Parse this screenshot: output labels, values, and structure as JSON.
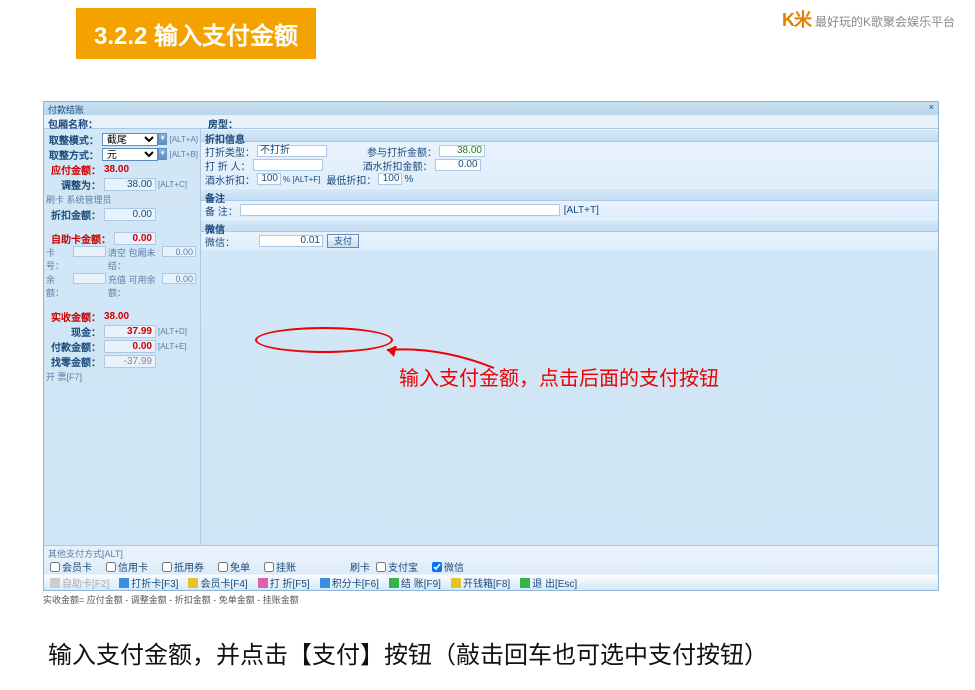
{
  "brand": {
    "logo": "K米",
    "slogan": "最好玩的K歌聚会娱乐平台"
  },
  "slide_title": "3.2.2 输入支付金额",
  "window": {
    "title": "付款结账",
    "room_label": "包厢名称：",
    "type_label": "房型：",
    "left": {
      "round_mode_l": "取整模式：",
      "round_mode_v": "截尾",
      "round_mode_hot": "[ALT+A]",
      "round_way_l": "取整方式：",
      "round_way_v": "元",
      "round_way_hot": "[ALT+B]",
      "pay_l": "应付金额：",
      "pay_v": "38.00",
      "adj_l": "调整为：",
      "adj_v": "38.00",
      "adj_hot": "[ALT+C]",
      "card_user": "刷卡 系统管理员",
      "disc_l": "折扣金额：",
      "disc_v": "0.00",
      "self_l": "自助卡金额：",
      "self_v": "0.00",
      "cardno_l": "卡号：",
      "cardno_v": "",
      "pkg_pending_l": "清空 包厢未结：",
      "pkg_pending_v": "0.00",
      "bal_l": "余额：",
      "bal_v": "",
      "avail_l": "充值 可用余额：",
      "avail_v": "0.00",
      "actual_l": "实收金额：",
      "actual_v": "38.00",
      "cash_l": "现金：",
      "cash_v": "37.99",
      "cash_hot": "[ALT+D]",
      "paid_l": "付款金额：",
      "paid_v": "0.00",
      "paid_hot": "[ALT+E]",
      "change_l": "找零金额：",
      "change_v": "-37.99",
      "invoice": "开 票[F7]"
    },
    "discount_panel": {
      "title": "折扣信息",
      "type_l": "打折类型：",
      "type_v": "不打折",
      "part_l": "参与打折金额：",
      "part_v": "38.00",
      "person_l": "打 折 人：",
      "person_v": "",
      "winedisc_total_l": "酒水折扣金额：",
      "winedisc_total_v": "0.00",
      "winedisc_l": "酒水折扣：",
      "winedisc_v": "100",
      "winedisc_unit": "% [ALT+F]",
      "min_l": "最低折扣：",
      "min_v": "100",
      "min_unit": "%"
    },
    "memo_panel": {
      "title": "备注",
      "memo_l": "备    注：",
      "memo_v": "",
      "memo_hot": "[ALT+T]"
    },
    "wechat_panel": {
      "title": "微信",
      "wx_l": "微信：",
      "wx_v": "0.01",
      "wx_btn": "支付"
    },
    "annotation": "输入支付金额，点击后面的支付按钮",
    "other": {
      "title": "其他支付方式[ALT]",
      "member": "会员卡",
      "credit": "信用卡",
      "coupon": "抵用券",
      "free": "免单",
      "hang": "挂账",
      "swipe_l": "刷卡",
      "alipay": "支付宝",
      "wechat": "微信"
    },
    "toolbar": {
      "self": "自助卡[F2]",
      "card": "打折卡[F3]",
      "member": "会员卡[F4]",
      "discount": "打 折[F5]",
      "point": "积分卡[F6]",
      "settle": "结 账[F9]",
      "cashbox": "开钱箱[F8]",
      "exit": "退 出[Esc]"
    }
  },
  "formula": "实收金额= 应付金额 - 调整金额 - 折扣金额 - 免单金额 - 挂账金额",
  "caption": "输入支付金额，并点击【支付】按钮（敲击回车也可选中支付按钮）"
}
